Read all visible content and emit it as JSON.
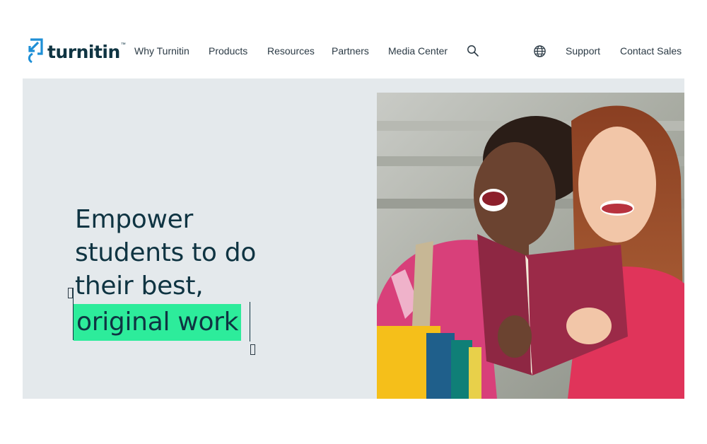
{
  "header": {
    "logo_text": "turnitin",
    "logo_tm": "™",
    "nav": [
      "Why Turnitin",
      "Products",
      "Resources",
      "Partners",
      "Media Center"
    ],
    "search_icon": "search-icon",
    "globe_icon": "globe-icon",
    "support_label": "Support",
    "contact_label": "Contact Sales"
  },
  "hero": {
    "headline_lines": [
      "Empower",
      "students to do",
      "their best,"
    ],
    "highlight": "original work",
    "image": "students-reading-book",
    "colors": {
      "background": "#e4e9ec",
      "headline": "#0f3442",
      "highlight": "#2dec9b",
      "brand_blue": "#1e8fd6"
    }
  }
}
